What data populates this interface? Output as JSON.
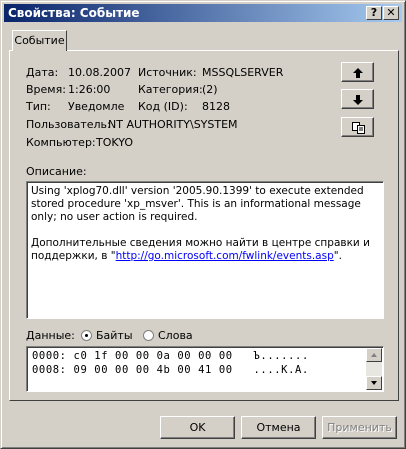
{
  "window": {
    "title": "Свойства: Событие"
  },
  "tab": {
    "label": "Событие"
  },
  "fields": {
    "date_label": "Дата:",
    "date_value": "10.08.2007",
    "source_label": "Источник:",
    "source_value": "MSSQLSERVER",
    "time_label": "Время:",
    "time_value": "1:26:00",
    "category_label": "Категория:",
    "category_value": "(2)",
    "type_label": "Тип:",
    "type_value": "Уведомле",
    "id_label": "Код (ID):",
    "id_value": "8128",
    "user_label": "Пользователь:",
    "user_value": "NT AUTHORITY\\SYSTEM",
    "computer_label": "Компьютер:",
    "computer_value": "TOKYO"
  },
  "description": {
    "label": "Описание:",
    "para1": "Using 'xplog70.dll' version '2005.90.1399' to execute extended stored procedure 'xp_msver'. This is an informational message only; no user action is required.",
    "para2_text": "Дополнительные сведения можно найти в центре справки и поддержки, в \"",
    "para2_link": "http://go.microsoft.com/fwlink/events.asp",
    "para2_end": "\"."
  },
  "data_section": {
    "label": "Данные:",
    "option_bytes": "Байты",
    "option_words": "Слова",
    "selected": "Байты",
    "lines": [
      "0000: c0 1f 00 00 0a 00 00 00   Ъ.......",
      "0008: 09 00 00 00 4b 00 41 00   ....K.A."
    ]
  },
  "buttons": {
    "ok": "OK",
    "cancel": "Отмена",
    "apply": "Применить"
  },
  "icons": {
    "up": "arrow-up-icon",
    "down": "arrow-down-icon",
    "copy": "copy-icon"
  }
}
